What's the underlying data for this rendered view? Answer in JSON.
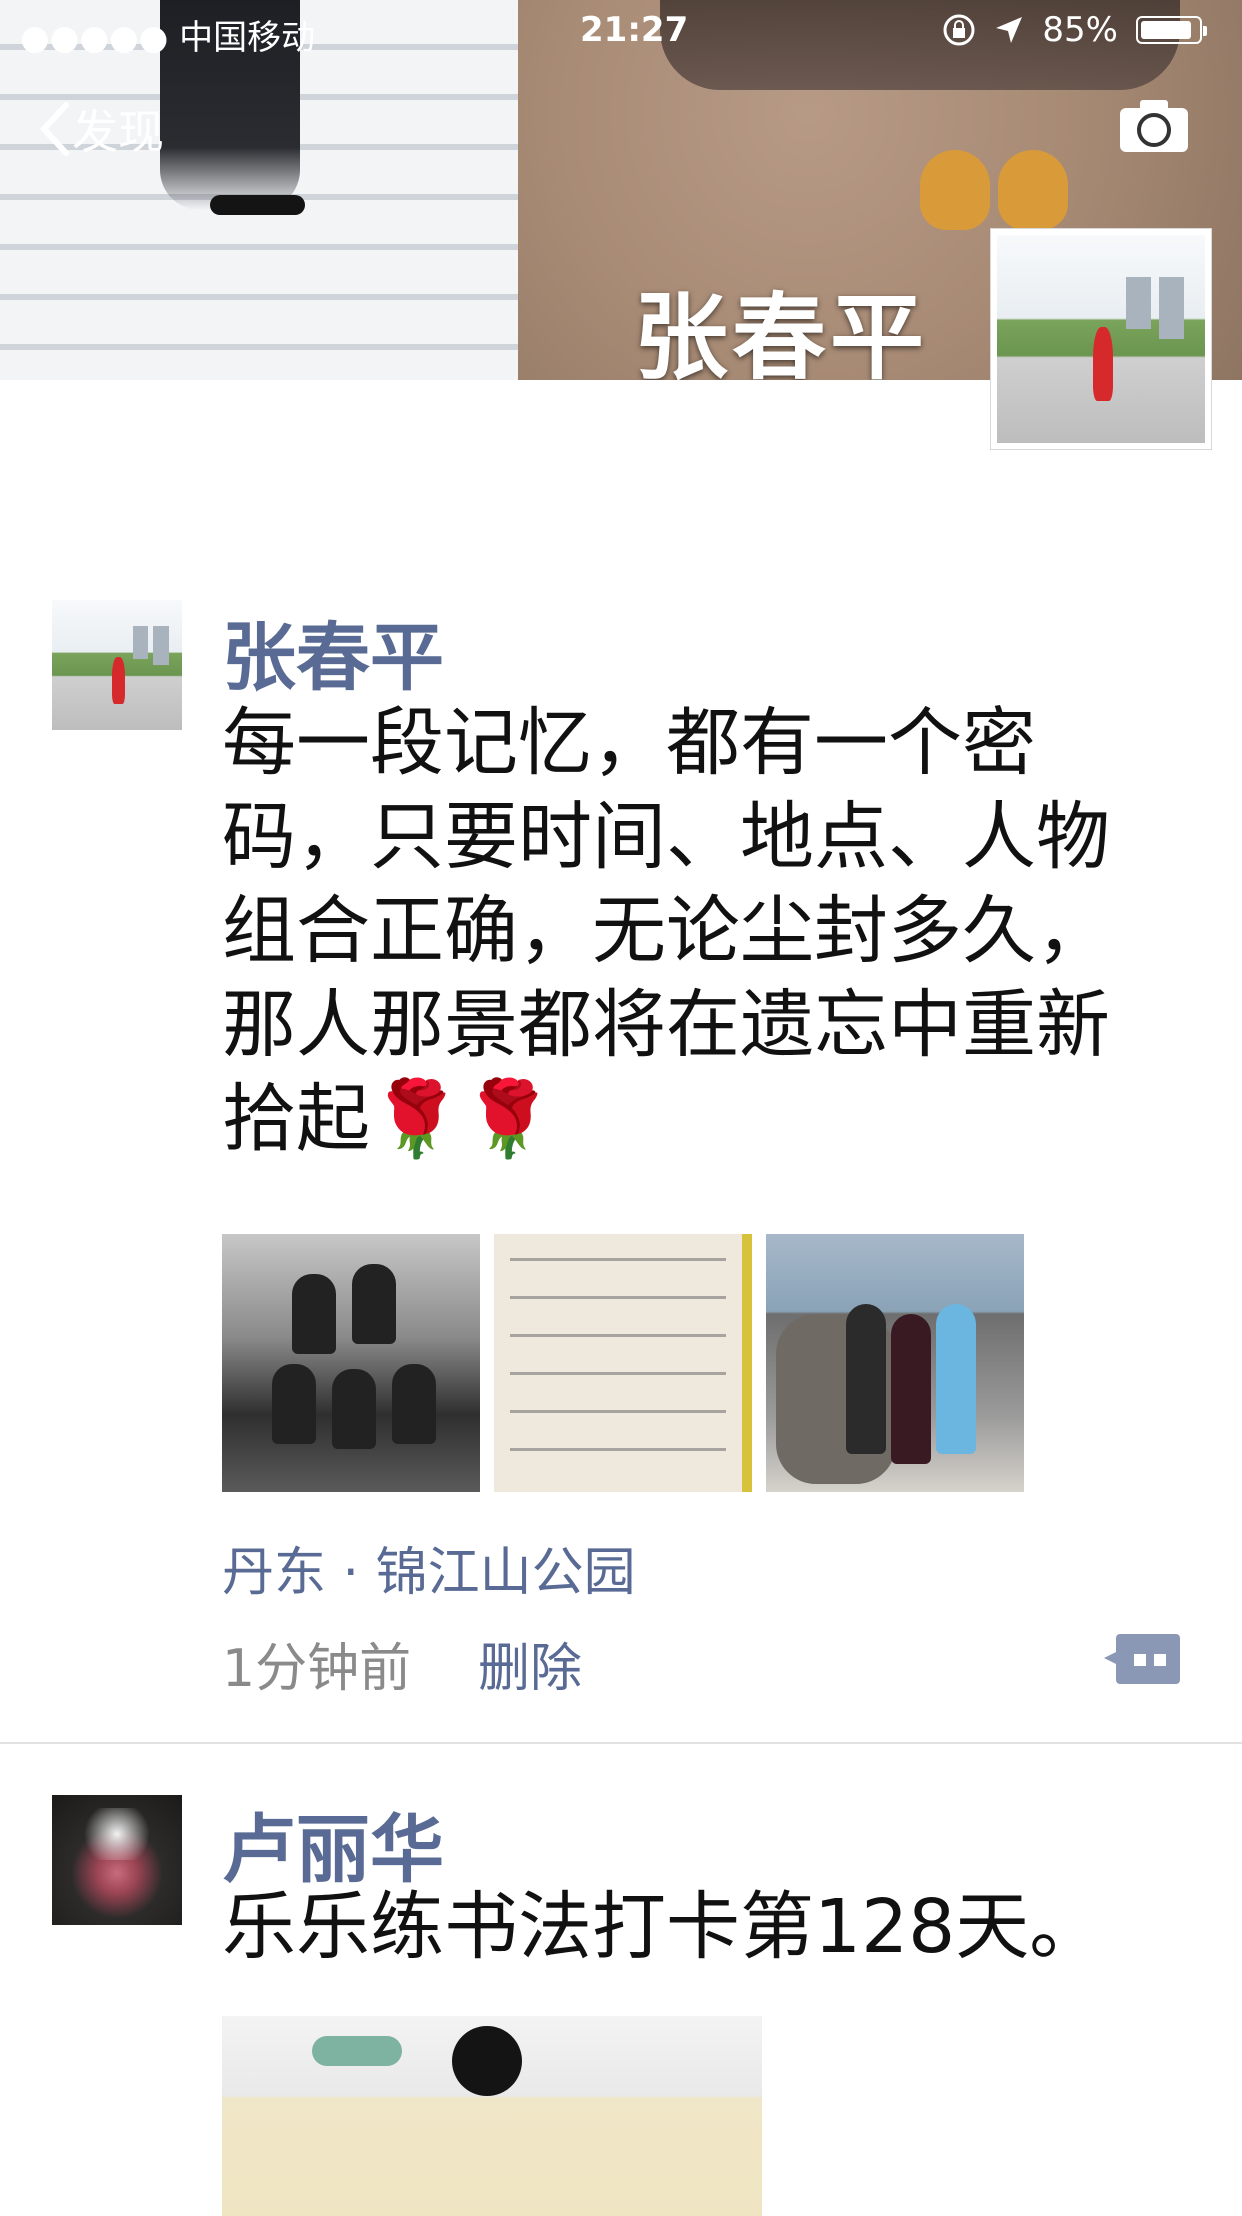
{
  "status_bar": {
    "carrier": "●●●●● 中国移动",
    "time": "21:27",
    "battery": "85%"
  },
  "nav": {
    "back_label": "发现"
  },
  "cover": {
    "name": "张春平"
  },
  "posts": [
    {
      "name": "张春平",
      "text": "每一段记忆，都有一个密码，只要时间、地点、人物组合正确，无论尘封多久，那人那景都将在遗忘中重新拾起🌹🌹",
      "location": "丹东 · 锦江山公园",
      "time": "1分钟前",
      "delete_label": "删除"
    },
    {
      "name": "卢丽华",
      "text": "乐乐练书法打卡第128天。"
    }
  ],
  "colors": {
    "link_blue": "#596b94",
    "meta_gray": "#8a8a8a",
    "divider": "#e2e2e2"
  },
  "icons": {
    "back": "chevron-left-icon",
    "camera": "camera-icon",
    "comment": "comment-icon",
    "lock": "orientation-lock-icon",
    "location_arrow": "location-arrow-icon",
    "wifi": "wifi-icon"
  }
}
